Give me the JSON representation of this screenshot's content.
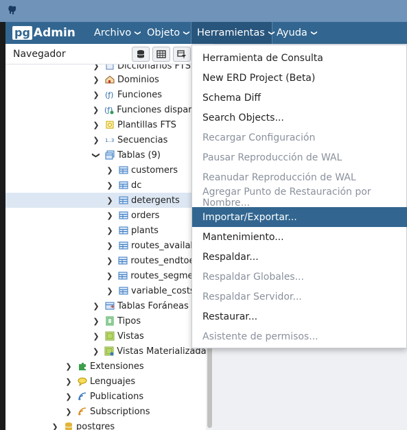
{
  "app": {
    "logo_pg": "pg",
    "logo_admin": "Admin",
    "accent_color": "#326690"
  },
  "menubar": {
    "items": [
      {
        "label": "Archivo"
      },
      {
        "label": "Objeto"
      },
      {
        "label": "Herramientas"
      },
      {
        "label": "Ayuda"
      }
    ]
  },
  "browser": {
    "title": "Navegador",
    "tree": [
      {
        "label": "Diccionarios FTS",
        "icon": "dictionary-icon"
      },
      {
        "label": "Dominios",
        "icon": "domain-icon"
      },
      {
        "label": "Funciones",
        "icon": "function-icon"
      },
      {
        "label": "Funciones disparadoras",
        "icon": "trigger-function-icon"
      },
      {
        "label": "Plantillas FTS",
        "icon": "template-icon"
      },
      {
        "label": "Secuencias",
        "icon": "sequence-icon"
      },
      {
        "label": "Tablas (9)",
        "icon": "tables-icon"
      },
      {
        "label": "customers",
        "icon": "table-icon"
      },
      {
        "label": "dc",
        "icon": "table-icon"
      },
      {
        "label": "detergents",
        "icon": "table-icon"
      },
      {
        "label": "orders",
        "icon": "table-icon"
      },
      {
        "label": "plants",
        "icon": "table-icon"
      },
      {
        "label": "routes_available",
        "icon": "table-icon"
      },
      {
        "label": "routes_endtoend",
        "icon": "table-icon"
      },
      {
        "label": "routes_segments",
        "icon": "table-icon"
      },
      {
        "label": "variable_costs",
        "icon": "table-icon"
      },
      {
        "label": "Tablas Foráneas",
        "icon": "foreign-table-icon"
      },
      {
        "label": "Tipos",
        "icon": "type-icon"
      },
      {
        "label": "Vistas",
        "icon": "view-icon"
      },
      {
        "label": "Vistas Materializadas",
        "icon": "materialized-view-icon"
      },
      {
        "label": "Extensiones",
        "icon": "extension-icon"
      },
      {
        "label": "Lenguajes",
        "icon": "language-icon"
      },
      {
        "label": "Publications",
        "icon": "publication-icon"
      },
      {
        "label": "Subscriptions",
        "icon": "subscription-icon"
      },
      {
        "label": "postgres",
        "icon": "database-icon"
      }
    ]
  },
  "tools_menu": {
    "items": [
      {
        "label": "Herramienta de Consulta",
        "enabled": true
      },
      {
        "label": "New ERD Project (Beta)",
        "enabled": true
      },
      {
        "label": "Schema Diff",
        "enabled": true
      },
      {
        "label": "Search Objects...",
        "enabled": true
      },
      {
        "label": "Recargar Configuración",
        "enabled": false
      },
      {
        "label": "Pausar Reproducción de WAL",
        "enabled": false
      },
      {
        "label": "Reanudar Reproducción de WAL",
        "enabled": false
      },
      {
        "label": "Agregar Punto de Restauración por Nombre...",
        "enabled": false
      },
      {
        "label": "Importar/Exportar...",
        "enabled": true,
        "highlighted": true
      },
      {
        "label": "Mantenimiento...",
        "enabled": true
      },
      {
        "label": "Respaldar...",
        "enabled": true
      },
      {
        "label": "Respaldar Globales...",
        "enabled": false
      },
      {
        "label": "Respaldar Servidor...",
        "enabled": false
      },
      {
        "label": "Restaurar...",
        "enabled": true
      },
      {
        "label": "Asistente de permisos...",
        "enabled": false
      }
    ]
  }
}
